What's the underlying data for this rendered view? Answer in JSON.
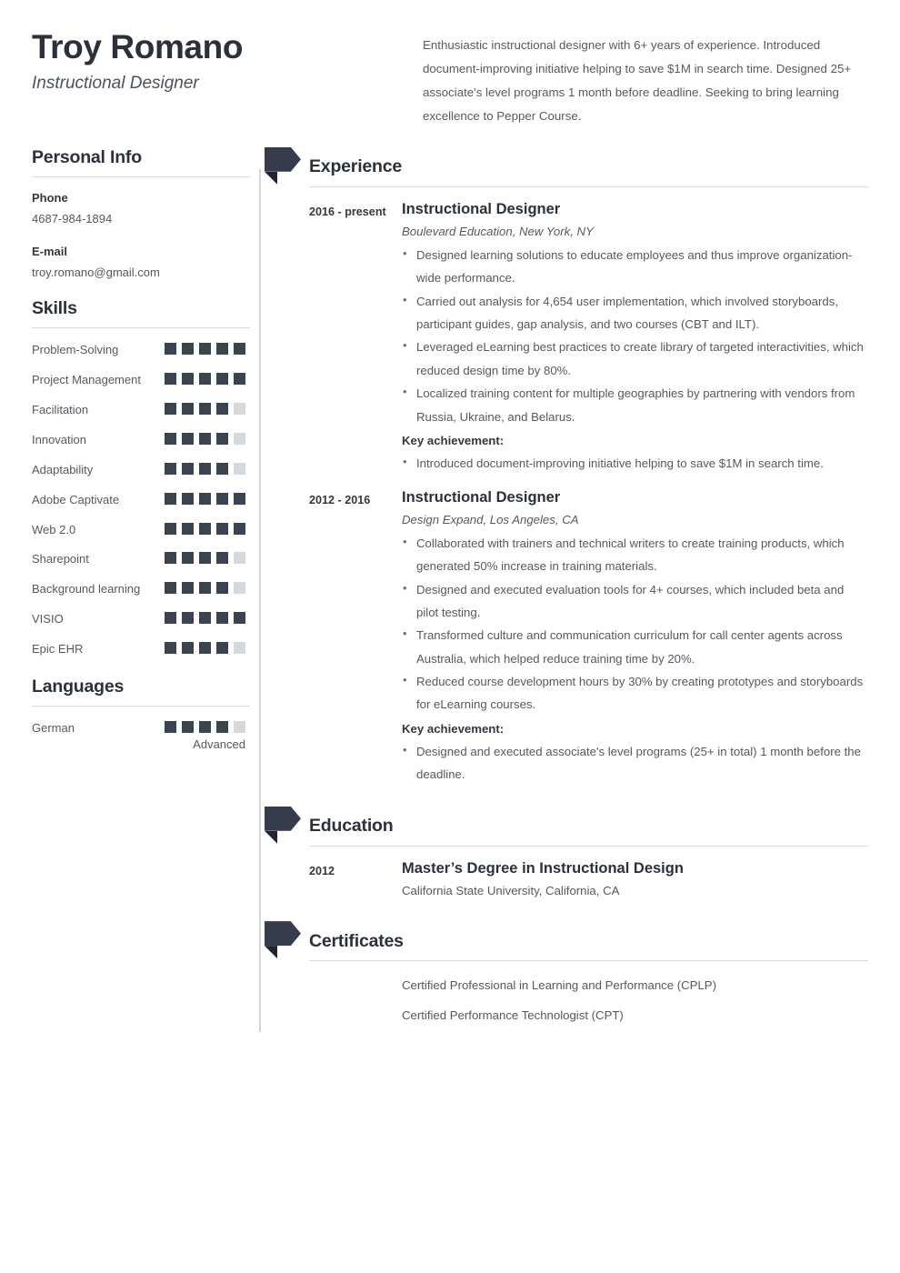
{
  "header": {
    "name": "Troy Romano",
    "job_title": "Instructional Designer",
    "summary": "Enthusiastic instructional designer with 6+ years of experience. Introduced document-improving initiative helping to save $1M in search time. Designed 25+ associate's level programs 1 month before deadline. Seeking to bring learning excellence to Pepper Course."
  },
  "colors": {
    "accent_dark": "#363c4b",
    "fold_dark": "#20242f",
    "heading": "#2b303b",
    "body_text": "#55595f",
    "rule": "#d9dadc",
    "rating_on": "#3b4250",
    "rating_off": "#d6d9dc"
  },
  "personal_info": {
    "heading": "Personal Info",
    "fields": [
      {
        "label": "Phone",
        "value": "4687-984-1894"
      },
      {
        "label": "E-mail",
        "value": "troy.romano@gmail.com"
      }
    ]
  },
  "skills": {
    "heading": "Skills",
    "max": 5,
    "items": [
      {
        "name": "Problem-Solving",
        "level": 5
      },
      {
        "name": "Project Management",
        "level": 5
      },
      {
        "name": "Facilitation",
        "level": 4
      },
      {
        "name": "Innovation",
        "level": 4
      },
      {
        "name": "Adaptability",
        "level": 4
      },
      {
        "name": "Adobe Captivate",
        "level": 5
      },
      {
        "name": "Web 2.0",
        "level": 5
      },
      {
        "name": "Sharepoint",
        "level": 4
      },
      {
        "name": "Background learning",
        "level": 4
      },
      {
        "name": "VISIO",
        "level": 5
      },
      {
        "name": "Epic EHR",
        "level": 4
      }
    ]
  },
  "languages": {
    "heading": "Languages",
    "max": 5,
    "items": [
      {
        "name": "German",
        "level": 4,
        "level_label": "Advanced"
      }
    ]
  },
  "experience": {
    "heading": "Experience",
    "entries": [
      {
        "date": "2016 - present",
        "title": "Instructional Designer",
        "subtitle": "Boulevard Education, New York, NY",
        "bullets": [
          "Designed learning solutions to educate employees and thus improve organization-wide performance.",
          "Carried out analysis for 4,654 user implementation, which involved storyboards, participant guides, gap analysis, and two courses (CBT and ILT).",
          "Leveraged eLearning best practices to create library of targeted interactivities, which reduced design time by 80%.",
          "Localized training content for multiple geographies by partnering with vendors from Russia, Ukraine, and Belarus."
        ],
        "key_achievement_label": "Key achievement:",
        "key_achievements": [
          "Introduced document-improving initiative helping to save $1M in search time."
        ]
      },
      {
        "date": "2012 - 2016",
        "title": "Instructional Designer",
        "subtitle": "Design Expand, Los Angeles, CA",
        "bullets": [
          "Collaborated with trainers and technical writers to create training products, which generated 50% increase in training materials.",
          "Designed and executed evaluation tools for 4+ courses, which included beta and pilot testing.",
          "Transformed culture and communication curriculum for call center agents across Australia, which helped reduce training time by 20%.",
          "Reduced course development hours by 30% by creating prototypes and storyboards for eLearning courses."
        ],
        "key_achievement_label": "Key achievement:",
        "key_achievements": [
          "Designed and executed associate's level programs (25+ in total) 1 month before the deadline."
        ]
      }
    ]
  },
  "education": {
    "heading": "Education",
    "entries": [
      {
        "date": "2012",
        "title": "Master’s Degree in Instructional Design",
        "subtitle": "California State University, California, CA"
      }
    ]
  },
  "certificates": {
    "heading": "Certificates",
    "items": [
      "Certified Professional in Learning and Performance (CPLP)",
      "Certified Performance Technologist (CPT)"
    ]
  }
}
